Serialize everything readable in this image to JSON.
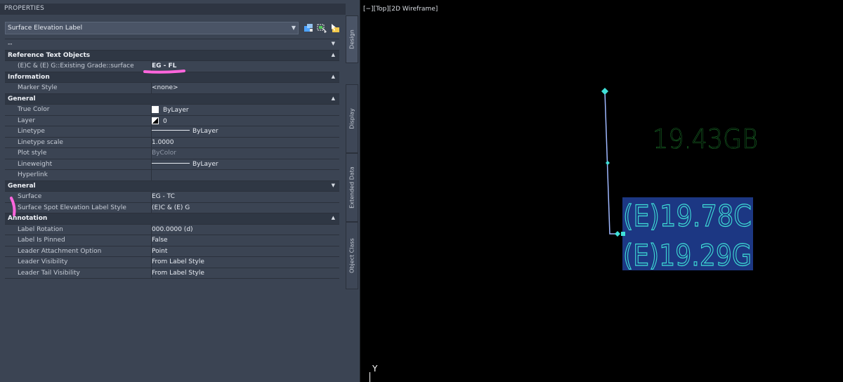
{
  "panel": {
    "title": "PROPERTIES",
    "object_select": "Surface Elevation Label",
    "empty_select": "--"
  },
  "sections": [
    {
      "label": "Reference Text Objects",
      "rows": [
        {
          "name": "(E)C & (E) G::Existing Grade::surface",
          "value": "EG - FL"
        }
      ]
    },
    {
      "label": "Information",
      "rows": [
        {
          "name": "Marker Style",
          "value": "<none>"
        }
      ]
    },
    {
      "label": "General",
      "rows": [
        {
          "name": "True Color",
          "value": "ByLayer"
        },
        {
          "name": "Layer",
          "value": "0"
        },
        {
          "name": "Linetype",
          "value": "ByLayer"
        },
        {
          "name": "Linetype scale",
          "value": "1.0000"
        },
        {
          "name": "Plot style",
          "value": "ByColor"
        },
        {
          "name": "Lineweight",
          "value": "ByLayer"
        },
        {
          "name": "Hyperlink",
          "value": ""
        }
      ]
    },
    {
      "label": "General",
      "rows": [
        {
          "name": "Surface",
          "value": "EG - TC"
        },
        {
          "name": "Surface Spot Elevation Label Style",
          "value": "(E)C & (E) G"
        }
      ]
    },
    {
      "label": "Annotation",
      "rows": [
        {
          "name": "Label Rotation",
          "value": "000.0000 (d)"
        },
        {
          "name": "Label Is Pinned",
          "value": "False"
        },
        {
          "name": "Leader Attachment Option",
          "value": "Point"
        },
        {
          "name": "Leader Visibility",
          "value": "From Label Style"
        },
        {
          "name": "Leader Tail Visibility",
          "value": "From Label Style"
        }
      ]
    }
  ],
  "tabs": [
    "Design",
    "Display",
    "Extended Data",
    "Object Class"
  ],
  "viewport": {
    "label": "[−][Top][2D Wireframe]",
    "ucs_y": "Y",
    "text_green": "19.43GB",
    "text_cyan_1": "(E)19.78C",
    "text_cyan_2": "(E)19.29G"
  },
  "colors": {
    "panel_bg": "#3b4453",
    "section_bg": "#2f3744",
    "highlight_pink": "#ff66dd",
    "cad_green": "#2fd04a",
    "cad_cyan": "#3fe0d8",
    "selection_blue": "#1e3a8a"
  },
  "icons": [
    "dropdown-arrow-icon",
    "quick-select-icon",
    "select-objects-icon",
    "toggle-pickadd-icon",
    "chevron-up-icon"
  ]
}
